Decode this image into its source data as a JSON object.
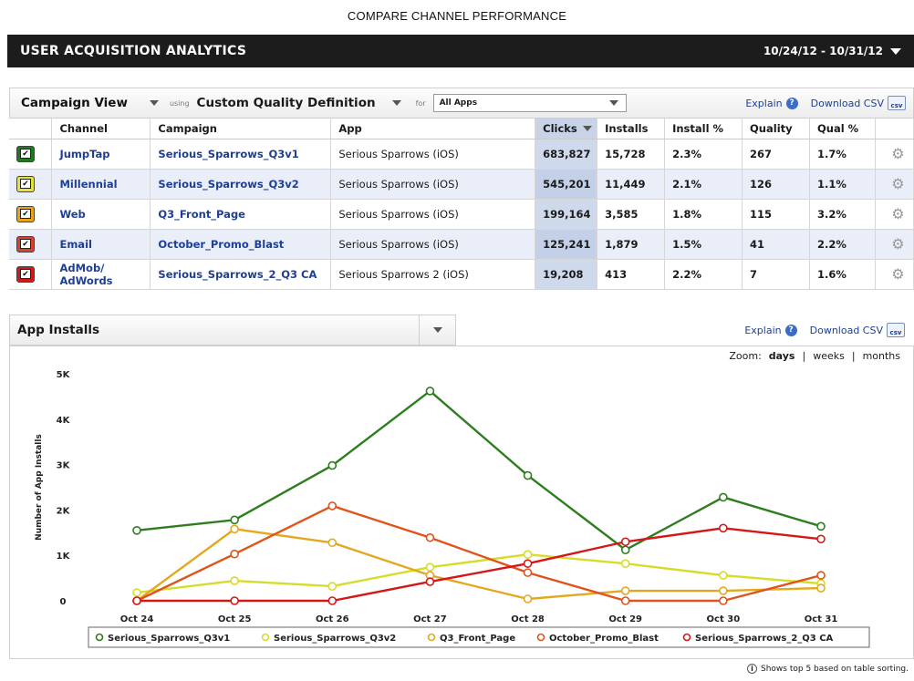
{
  "page_caption": "COMPARE CHANNEL PERFORMANCE",
  "header": {
    "title": "USER ACQUISITION ANALYTICS",
    "date_range": "10/24/12 - 10/31/12"
  },
  "campaign_panel": {
    "view_label": "Campaign View",
    "using_label": "using",
    "definition_label": "Custom Quality Definition",
    "for_label": "for",
    "app_filter": "All Apps",
    "explain": "Explain",
    "download_csv": "Download CSV"
  },
  "table": {
    "columns": [
      "Channel",
      "Campaign",
      "App",
      "Clicks",
      "Installs",
      "Install %",
      "Quality",
      "Qual %"
    ],
    "rows": [
      {
        "color": "#1e7a1e",
        "channel": "JumpTap",
        "campaign": "Serious_Sparrows_Q3v1",
        "app": "Serious Sparrows (iOS)",
        "clicks": "683,827",
        "installs": "15,728",
        "install_pct": "2.3%",
        "quality": "267",
        "qual_pct": "1.7%"
      },
      {
        "color": "#e6e23a",
        "channel": "Millennial",
        "campaign": "Serious_Sparrows_Q3v2",
        "app": "Serious Sparrows (iOS)",
        "clicks": "545,201",
        "installs": "11,449",
        "install_pct": "2.1%",
        "quality": "126",
        "qual_pct": "1.1%"
      },
      {
        "color": "#e8a21c",
        "channel": "Web",
        "campaign": "Q3_Front_Page",
        "app": "Serious Sparrows (iOS)",
        "clicks": "199,164",
        "installs": "3,585",
        "install_pct": "1.8%",
        "quality": "115",
        "qual_pct": "3.2%"
      },
      {
        "color": "#d8422a",
        "channel": "Email",
        "campaign": "October_Promo_Blast",
        "app": "Serious Sparrows (iOS)",
        "clicks": "125,241",
        "installs": "1,879",
        "install_pct": "1.5%",
        "quality": "41",
        "qual_pct": "2.2%"
      },
      {
        "color": "#d01a1a",
        "channel": "AdMob/ AdWords",
        "campaign": "Serious_Sparrows_2_Q3 CA",
        "app": "Serious Sparrows 2 (iOS)",
        "clicks": "19,208",
        "installs": "413",
        "install_pct": "2.2%",
        "quality": "7",
        "qual_pct": "1.6%"
      }
    ]
  },
  "installs_panel": {
    "title": "App Installs",
    "explain": "Explain",
    "download_csv": "Download CSV",
    "zoom_label": "Zoom:",
    "zoom_options": [
      "days",
      "weeks",
      "months"
    ],
    "zoom_active": "days",
    "separator": "|"
  },
  "chart_data": {
    "type": "line",
    "title": "",
    "xlabel": "",
    "ylabel": "Number of App Installs",
    "x": [
      "Oct 24",
      "Oct 25",
      "Oct 26",
      "Oct 27",
      "Oct 28",
      "Oct 29",
      "Oct 30",
      "Oct 31"
    ],
    "ylim": [
      0,
      5000
    ],
    "yticks": [
      0,
      1000,
      2000,
      3000,
      4000,
      5000
    ],
    "ytick_labels": [
      "0",
      "1K",
      "2K",
      "3K",
      "4K",
      "5K"
    ],
    "legend_position": "bottom",
    "series": [
      {
        "name": "Serious_Sparrows_Q3v1",
        "color": "#2e7d1e",
        "values": [
          1550,
          1780,
          2980,
          4620,
          2760,
          1120,
          2280,
          1640
        ]
      },
      {
        "name": "Serious_Sparrows_Q3v2",
        "color": "#d6dc2a",
        "values": [
          180,
          440,
          320,
          740,
          1020,
          820,
          560,
          380
        ]
      },
      {
        "name": "Q3_Front_Page",
        "color": "#e3a81e",
        "values": [
          0,
          1580,
          1280,
          560,
          40,
          220,
          220,
          280
        ]
      },
      {
        "name": "October_Promo_Blast",
        "color": "#e0531c",
        "values": [
          0,
          1030,
          2090,
          1390,
          620,
          0,
          0,
          560
        ]
      },
      {
        "name": "Serious_Sparrows_2_Q3 CA",
        "color": "#d41818",
        "values": [
          0,
          0,
          0,
          420,
          820,
          1300,
          1600,
          1360
        ]
      }
    ]
  },
  "footnote": "Shows top 5 based on table sorting.",
  "info_icon_glyph": "i",
  "help_icon_glyph": "?",
  "csv_icon_text": "csv",
  "checkmark_glyph": "✔",
  "gear_glyph": "⚙"
}
